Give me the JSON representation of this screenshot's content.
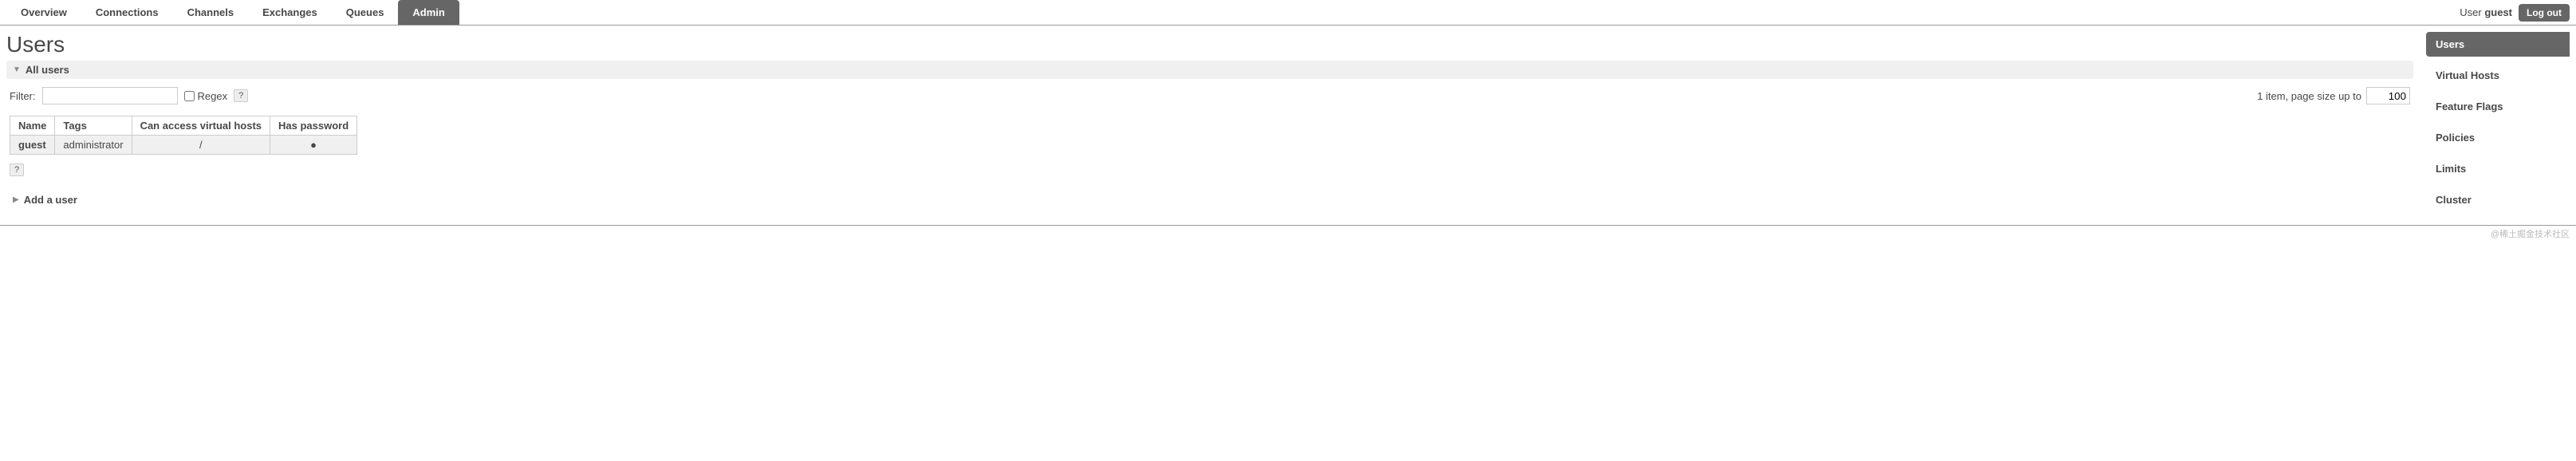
{
  "nav": {
    "tabs": [
      "Overview",
      "Connections",
      "Channels",
      "Exchanges",
      "Queues",
      "Admin"
    ],
    "active_index": 5
  },
  "user_info": {
    "label": "User",
    "name": "guest",
    "logout": "Log out"
  },
  "page": {
    "title": "Users"
  },
  "all_users": {
    "heading": "All users",
    "filter_label": "Filter:",
    "filter_value": "",
    "regex_label": "Regex",
    "pager_text": "1 item, page size up to",
    "page_size": "100",
    "help": "?",
    "columns": [
      "Name",
      "Tags",
      "Can access virtual hosts",
      "Has password"
    ],
    "rows": [
      {
        "name": "guest",
        "tags": "administrator",
        "vhosts": "/",
        "has_password": "●"
      }
    ],
    "below_help": "?"
  },
  "add_user": {
    "heading": "Add a user"
  },
  "sidebar": {
    "items": [
      "Users",
      "Virtual Hosts",
      "Feature Flags",
      "Policies",
      "Limits",
      "Cluster"
    ],
    "active_index": 0
  },
  "watermark": "@稀土掘金技术社区"
}
